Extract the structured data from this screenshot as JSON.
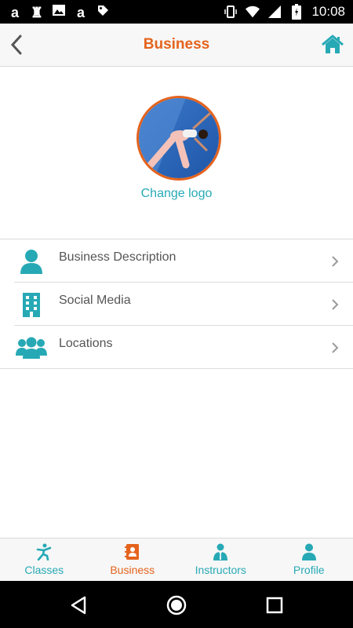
{
  "status_bar": {
    "time": "10:08",
    "left_icons": [
      "amazon-icon",
      "chess-icon",
      "image-icon",
      "amazon-icon",
      "tag-icon"
    ],
    "right_icons": [
      "vibrate-icon",
      "wifi-icon",
      "signal-icon",
      "battery-icon"
    ]
  },
  "header": {
    "title": "Business",
    "back_icon": "chevron-left-icon",
    "home_icon": "home-icon"
  },
  "logo": {
    "change_label": "Change logo"
  },
  "menu": {
    "items": [
      {
        "label": "Business Description",
        "icon": "person-icon"
      },
      {
        "label": "Social Media",
        "icon": "building-icon"
      },
      {
        "label": "Locations",
        "icon": "group-icon"
      }
    ]
  },
  "bottom_nav": {
    "active": "Business",
    "tabs": [
      {
        "label": "Classes",
        "icon": "running-figure-icon"
      },
      {
        "label": "Business",
        "icon": "contact-book-icon"
      },
      {
        "label": "Instructors",
        "icon": "instructor-icon"
      },
      {
        "label": "Profile",
        "icon": "person-icon"
      }
    ]
  },
  "colors": {
    "accent": "#e5631c",
    "teal": "#27a9b5"
  }
}
